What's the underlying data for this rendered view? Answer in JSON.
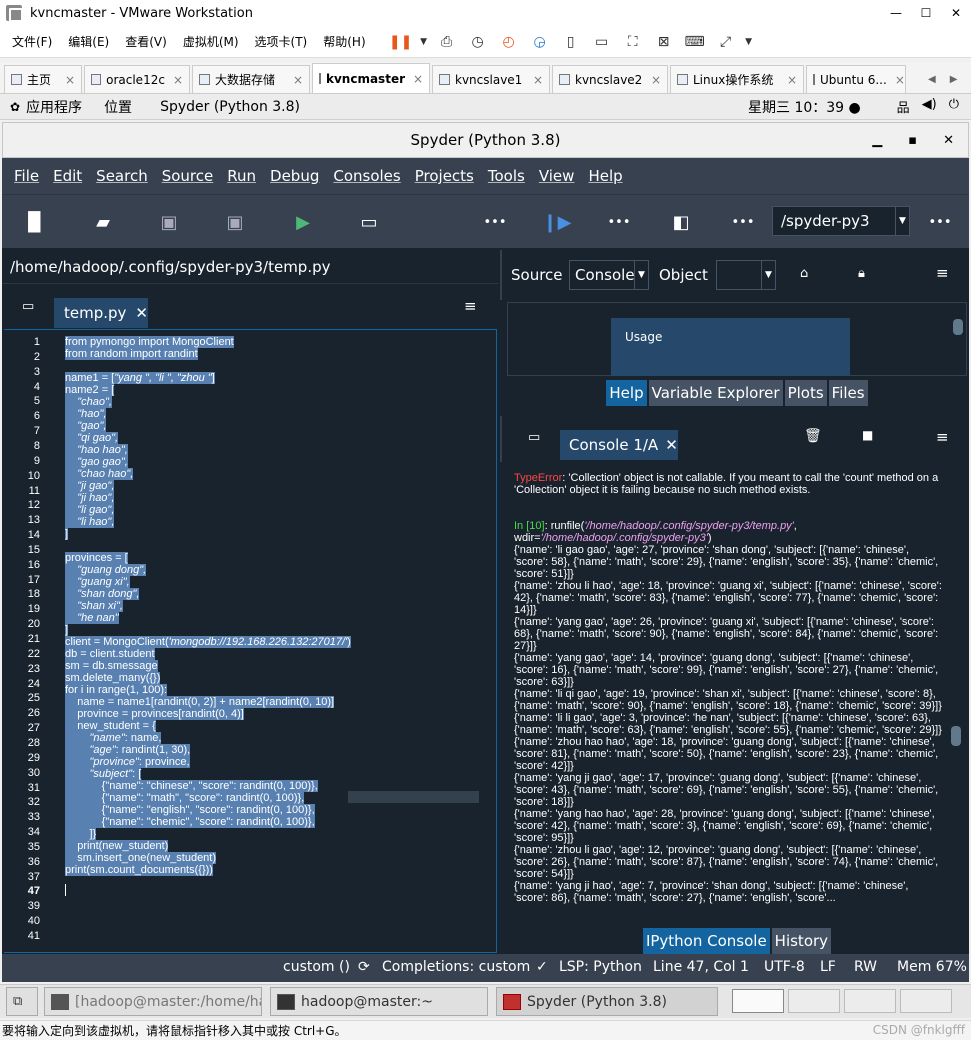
{
  "vm": {
    "title": "kvncmaster - VMware Workstation",
    "menu": [
      "文件(F)",
      "编辑(E)",
      "查看(V)",
      "虚拟机(M)",
      "选项卡(T)",
      "帮助(H)"
    ],
    "tabs": [
      "主页",
      "oracle12c",
      "大数据存储",
      "kvncmaster",
      "kvncslave1",
      "kvncslave2",
      "Linux操作系统",
      "Ubuntu 6..."
    ]
  },
  "gnome": {
    "apps": "应用程序",
    "places": "位置",
    "active_app": "Spyder (Python 3.8)",
    "clock": "星期三 10：39 ●"
  },
  "spyder": {
    "title": "Spyder (Python 3.8)",
    "menu": [
      "File",
      "Edit",
      "Search",
      "Source",
      "Run",
      "Debug",
      "Consoles",
      "Projects",
      "Tools",
      "View",
      "Help"
    ],
    "pythonpath": "/spyder-py3",
    "editor_path": "/home/hadoop/.config/spyder-py3/temp.py",
    "editor_tab": "temp.py",
    "help": {
      "source_label": "Source",
      "source_value": "Console",
      "object_label": "Object",
      "usage": "Usage",
      "tabs": [
        "Help",
        "Variable Explorer",
        "Plots",
        "Files"
      ]
    },
    "console": {
      "tab": "Console 1/A",
      "bottom_tabs": [
        "IPython Console",
        "History"
      ]
    },
    "status": {
      "custom": "custom ()",
      "completions": "Completions: custom",
      "lsp": "LSP: Python",
      "position": "Line 47, Col 1",
      "encoding": "UTF-8",
      "eol": "LF",
      "rw": "RW",
      "mem": "Mem 67%"
    }
  },
  "taskbar": {
    "t1": "[hadoop@master:/home/had···",
    "t2": "hadoop@master:~",
    "t3": "Spyder (Python 3.8)"
  },
  "hint": "要将输入定向到该虚拟机，请将鼠标指针移入其中或按 Ctrl+G。",
  "watermark": "CSDN @fnklgfff",
  "code": {
    "l1": "from pymongo import MongoClient",
    "l2": "from random import randint",
    "l4a": "name1 = [",
    "l4b": "\"yang \", \"li \", \"zhou \"",
    "l4c": "]",
    "l5": "name2 = [",
    "l6": "    \"chao\",",
    "l7": "    \"hao\",",
    "l8": "    \"gao\",",
    "l9": "    \"qi gao\",",
    "l10": "    \"hao hao\",",
    "l11": "    \"gao gao\",",
    "l12": "    \"chao hao\",",
    "l13": "    \"ji gao\",",
    "l14": "    \"ji hao\",",
    "l15": "    \"li gao\",",
    "l16": "    \"li hao\",",
    "l17": "]",
    "l19": "provinces = [",
    "l20": "    \"guang dong\",",
    "l21": "    \"guang xi\",",
    "l22": "    \"shan dong\",",
    "l23": "    \"shan xi\",",
    "l24": "    \"he nan\"",
    "l25": "]",
    "l26a": "client = MongoClient(",
    "l26b": "'mongodb://192.168.226.132:27017/'",
    "l26c": ")",
    "l27": "db = client.student",
    "l28": "sm = db.smessage",
    "l29": "sm.delete_many({})",
    "l30": "for i in range(1, 100):",
    "l31": "    name = name1[randint(0, 2)] + name2[randint(0, 10)]",
    "l32": "    province = provinces[randint(0, 4)]",
    "l33": "    new_student = {",
    "l34a": "        ",
    "l34b": "\"name\"",
    "l34c": ": name,",
    "l35b": "\"age\"",
    "l35c": ": randint(1, 30),",
    "l36b": "\"province\"",
    "l36c": ": province,",
    "l37b": "\"subject\"",
    "l37c": ": [",
    "l38": "            {\"name\": \"chinese\", \"score\": randint(0, 100)},",
    "l39": "            {\"name\": \"math\", \"score\": randint(0, 100)},",
    "l40": "            {\"name\": \"english\", \"score\": randint(0, 100)},",
    "l41": "            {\"name\": \"chemic\", \"score\": randint(0, 100)},",
    "l42": "        ]}",
    "l43": "    print(new_student)",
    "l44": "    sm.insert_one(new_student)",
    "l45": "print(sm.count_documents({}))"
  },
  "gutter": [
    "1",
    "2",
    "3",
    "4",
    "5",
    "6",
    "7",
    "8",
    "9",
    "10",
    "11",
    "12",
    "13",
    "14",
    "15",
    "16",
    "17",
    "18",
    "19",
    "20",
    "21",
    "22",
    "23",
    "24",
    "25",
    "26",
    "27",
    "28",
    "29",
    "30",
    "31",
    "32",
    "33",
    "34",
    "35",
    "36",
    "37",
    "47",
    "39",
    "40",
    "41"
  ],
  "console_lines": {
    "err_label": "TypeError",
    "err_msg": ": 'Collection' object is not callable. If you meant to call the 'count' method on a 'Collection' object it is failing because no such method exists.",
    "prompt": "In [10]",
    "runfile_a": ": runfile(",
    "runfile_b": "'/home/hadoop/.config/spyder-py3/temp.py'",
    "runfile_c": ", wdir=",
    "runfile_d": "'/home/hadoop/.config/spyder-py3'",
    "runfile_e": ")",
    "r1": "{'name': 'li gao gao', 'age': 27, 'province': 'shan dong', 'subject': [{'name': 'chinese', 'score': 58}, {'name': 'math', 'score': 29}, {'name': 'english', 'score': 35}, {'name': 'chemic', 'score': 51}]}",
    "r2": "{'name': 'zhou li hao', 'age': 18, 'province': 'guang xi', 'subject': [{'name': 'chinese', 'score': 42}, {'name': 'math', 'score': 83}, {'name': 'english', 'score': 77}, {'name': 'chemic', 'score': 14}]}",
    "r3": "{'name': 'yang gao', 'age': 26, 'province': 'guang xi', 'subject': [{'name': 'chinese', 'score': 68}, {'name': 'math', 'score': 90}, {'name': 'english', 'score': 84}, {'name': 'chemic', 'score': 27}]}",
    "r4": "{'name': 'yang gao', 'age': 14, 'province': 'guang dong', 'subject': [{'name': 'chinese', 'score': 16}, {'name': 'math', 'score': 99}, {'name': 'english', 'score': 27}, {'name': 'chemic', 'score': 63}]}",
    "r5": "{'name': 'li qi gao', 'age': 19, 'province': 'shan xi', 'subject': [{'name': 'chinese', 'score': 8}, {'name': 'math', 'score': 90}, {'name': 'english', 'score': 18}, {'name': 'chemic', 'score': 39}]}",
    "r6": "{'name': 'li li gao', 'age': 3, 'province': 'he nan', 'subject': [{'name': 'chinese', 'score': 63}, {'name': 'math', 'score': 63}, {'name': 'english', 'score': 55}, {'name': 'chemic', 'score': 29}]}",
    "r7": "{'name': 'zhou hao hao', 'age': 18, 'province': 'guang dong', 'subject': [{'name': 'chinese', 'score': 81}, {'name': 'math', 'score': 50}, {'name': 'english', 'score': 23}, {'name': 'chemic', 'score': 42}]}",
    "r8": "{'name': 'yang ji gao', 'age': 17, 'province': 'guang dong', 'subject': [{'name': 'chinese', 'score': 43}, {'name': 'math', 'score': 69}, {'name': 'english', 'score': 55}, {'name': 'chemic', 'score': 18}]}",
    "r9": "{'name': 'yang hao hao', 'age': 28, 'province': 'guang dong', 'subject': [{'name': 'chinese', 'score': 42}, {'name': 'math', 'score': 3}, {'name': 'english', 'score': 69}, {'name': 'chemic', 'score': 95}]}",
    "r10": "{'name': 'zhou li gao', 'age': 12, 'province': 'guang dong', 'subject': [{'name': 'chinese', 'score': 26}, {'name': 'math', 'score': 87}, {'name': 'english', 'score': 74}, {'name': 'chemic', 'score': 54}]}",
    "r11": "{'name': 'yang ji hao', 'age': 7, 'province': 'shan dong', 'subject': [{'name': 'chinese', 'score': 86}, {'name': 'math', 'score': 27}, {'name': 'english', 'score'..."
  }
}
